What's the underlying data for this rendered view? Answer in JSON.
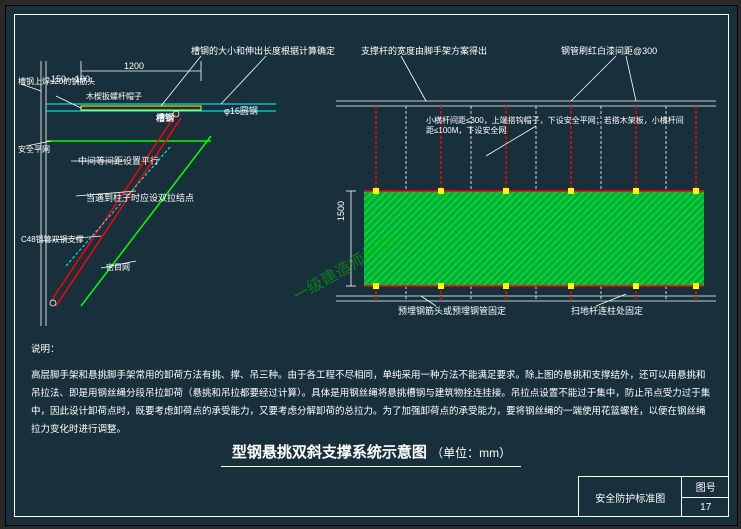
{
  "annotations": {
    "a_dim1200": "1200",
    "a_dim150_100": "150—100",
    "a_top1": "槽钢的大小和伸出长度根据计算确定",
    "a_top2": "支撑杆的宽度由脚手架方案得出",
    "a_top3": "钢管刷红白漆间距@300",
    "a_left1": "槽钢上焊≤20的钢筋头",
    "a_left2": "木楔扳螺杆帽子",
    "a_label_canggang": "槽钢",
    "a_phi16": "φ16圆钢",
    "a_safety": "安全平网",
    "a_midspan": "中间等间距设置平行",
    "a_pull": "当遇到柱子时应设双拉结点",
    "a_c48": "C48钢管双钢支撑",
    "a_mimu": "密目网",
    "a_scissor": "小横杆间距≤300，上端搭钩帽子，下设安全平网；若搭木架板，小横杆间距≤100M，下设安全网",
    "a_1500": "1500",
    "a_bottom1": "预埋钢筋头或预埋钢管固定",
    "a_bottom2": "扫地杆连柱处固定",
    "a_watermark": "一级建造师林辉",
    "explain_label": "说明：",
    "explain_body": "高层脚手架和悬挑脚手架常用的卸荷方法有挑、撑、吊三种。由于各工程不尽相同，单纯采用一种方法不能满足要求。除上图的悬挑和支撑结外，还可以用悬挑和吊拉法、即是用钢丝绳分段吊拉卸荷（悬挑和吊拉都要经过计算）。具体是用钢丝绳将悬挑槽钢与建筑物拴连挂接。吊拉点设置不能过于集中，防止吊点受力过于集中，因此设计卸荷点时，既要考虑卸荷点的承受能力，又要考虑分解卸荷的总拉力。为了加强卸荷点的承受能力，要将钢丝绳的一端使用花篮螺栓，以便在钢丝绳拉力变化时进行调整。",
    "title_main": "型钢悬挑双斜支撑系统示意图",
    "title_unit": "（单位：mm）",
    "titlebar_main": "安全防护标准图",
    "titlebar_label": "图号",
    "titlebar_no": "17"
  }
}
